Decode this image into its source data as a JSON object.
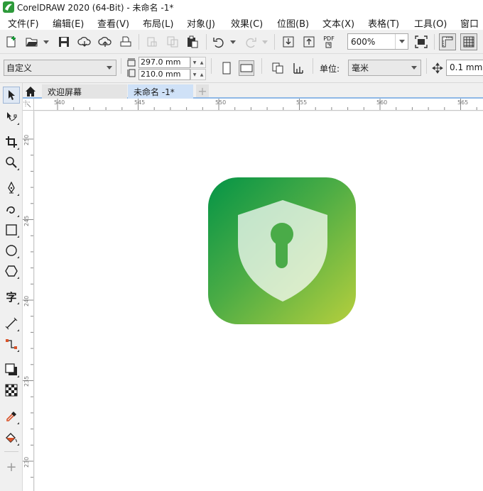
{
  "window": {
    "title": "CorelDRAW 2020 (64-Bit) - 未命名 -1*"
  },
  "menu": {
    "items": [
      {
        "label": "文件(F)"
      },
      {
        "label": "编辑(E)"
      },
      {
        "label": "查看(V)"
      },
      {
        "label": "布局(L)"
      },
      {
        "label": "对象(J)"
      },
      {
        "label": "效果(C)"
      },
      {
        "label": "位图(B)"
      },
      {
        "label": "文本(X)"
      },
      {
        "label": "表格(T)"
      },
      {
        "label": "工具(O)"
      },
      {
        "label": "窗口"
      }
    ]
  },
  "toolbar": {
    "zoom": "600%",
    "pdf_label": "PDF"
  },
  "property_bar": {
    "page_preset": "自定义",
    "page_width": "297.0 mm",
    "page_height": "210.0 mm",
    "units_label": "单位:",
    "units_value": "毫米",
    "nudge": "0.1 mm"
  },
  "tabs": {
    "welcome": "欢迎屏幕",
    "document": "未命名 -1*",
    "add": "+"
  },
  "rulers": {
    "horizontal": [
      "540",
      "545",
      "550",
      "555",
      "560",
      "565"
    ],
    "vertical": [
      "250",
      "245",
      "240",
      "235",
      "230"
    ]
  },
  "toolbox": {
    "text_tool_glyph": "字",
    "add_glyph": "+"
  },
  "artwork": {
    "tile_gradient": [
      "#049447",
      "#4bac45",
      "#b6cf3d"
    ],
    "shield_color": "#ffffff",
    "keyhole_color": "#4aab48"
  }
}
